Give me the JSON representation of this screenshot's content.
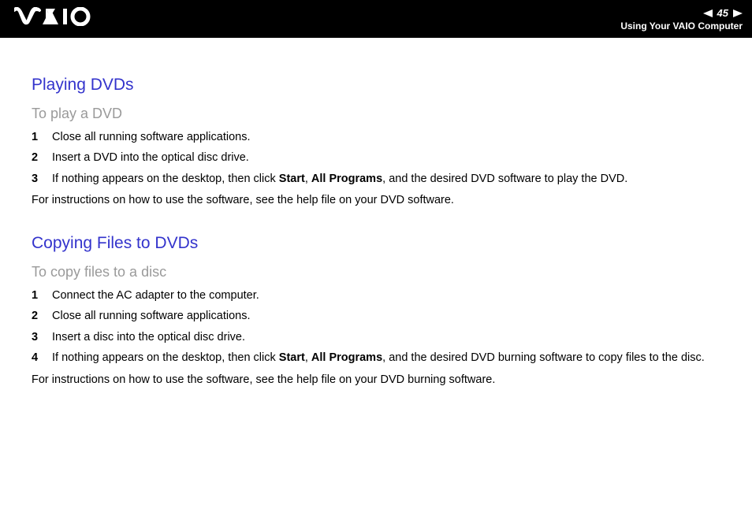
{
  "header": {
    "page_number": "45",
    "subtitle": "Using Your VAIO Computer"
  },
  "section1": {
    "title": "Playing DVDs",
    "subtitle": "To play a DVD",
    "steps": [
      {
        "num": "1",
        "text": "Close all running software applications."
      },
      {
        "num": "2",
        "text": "Insert a DVD into the optical disc drive."
      },
      {
        "num": "3",
        "pre": "If nothing appears on the desktop, then click ",
        "b1": "Start",
        "mid1": ", ",
        "b2": "All Programs",
        "post": ", and the desired DVD software to play the DVD."
      }
    ],
    "note": "For instructions on how to use the software, see the help file on your DVD software."
  },
  "section2": {
    "title": "Copying Files to DVDs",
    "subtitle": "To copy files to a disc",
    "steps": [
      {
        "num": "1",
        "text": "Connect the AC adapter to the computer."
      },
      {
        "num": "2",
        "text": "Close all running software applications."
      },
      {
        "num": "3",
        "text": "Insert a disc into the optical disc drive."
      },
      {
        "num": "4",
        "pre": "If nothing appears on the desktop, then click ",
        "b1": "Start",
        "mid1": ", ",
        "b2": "All Programs",
        "post": ", and the desired DVD burning software to copy files to the disc."
      }
    ],
    "note": "For instructions on how to use the software, see the help file on your DVD burning software."
  }
}
